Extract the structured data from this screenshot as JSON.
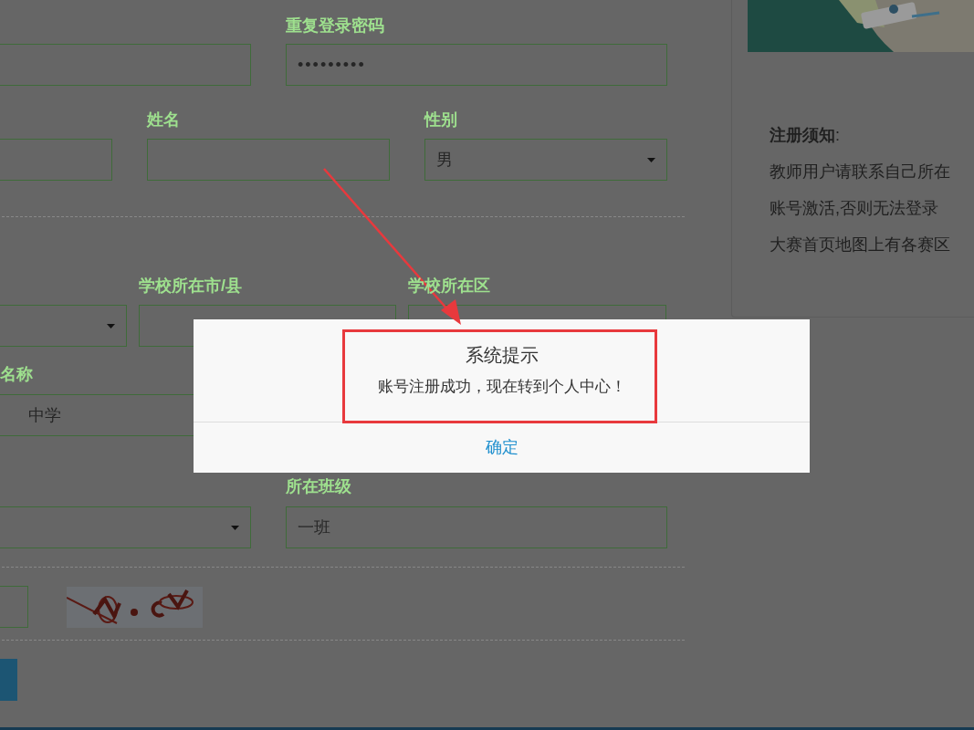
{
  "form": {
    "password_repeat": {
      "label": "重复登录密码",
      "value": "•••••••••"
    },
    "name": {
      "label": "姓名"
    },
    "gender": {
      "label": "性别",
      "value": "男"
    },
    "city": {
      "label": "学校所在市/县"
    },
    "district": {
      "label": "学校所在区"
    },
    "school": {
      "label": "名称",
      "value": "中学"
    },
    "class": {
      "label": "所在班级",
      "value": "一班"
    }
  },
  "notice": {
    "title": "**注册须知**:",
    "lines": [
      "教师用户请联系自己所在",
      "账号激活,否则无法登录",
      "大赛首页地图上有各赛区"
    ]
  },
  "dialog": {
    "title": "系统提示",
    "message": "账号注册成功，现在转到个人中心！",
    "button": "确定"
  }
}
